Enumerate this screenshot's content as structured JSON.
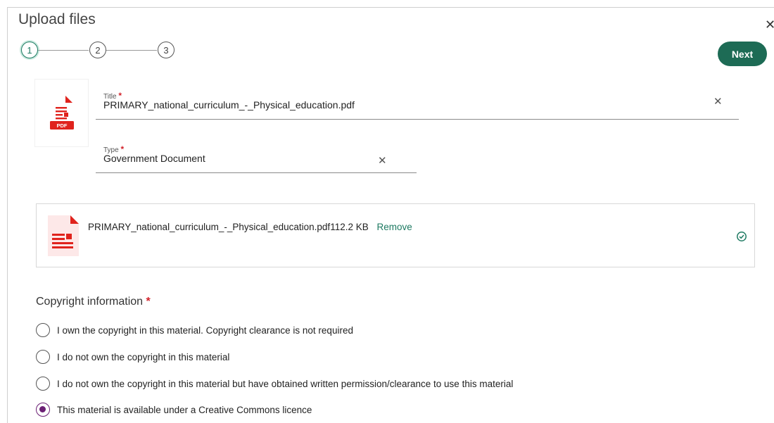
{
  "dialog": {
    "title": "Upload files",
    "close_icon": "close-icon"
  },
  "stepper": {
    "steps": [
      "1",
      "2",
      "3"
    ],
    "active_step": "1",
    "accent": "#1e7a62"
  },
  "actions": {
    "next_label": "Next",
    "next_color": "#1d6b55"
  },
  "form": {
    "title_label": "Title",
    "title_value": "PRIMARY_national_curriculum_-_Physical_education.pdf",
    "type_label": "Type",
    "type_value": "Government Document",
    "required_marker": "*"
  },
  "file": {
    "badge": "PDF",
    "name": "PRIMARY_national_curriculum_-_Physical_education.pdf",
    "size": "112.2 KB",
    "remove_label": "Remove",
    "status_icon": "check-circle-icon"
  },
  "copyright": {
    "heading": "Copyright information",
    "options": [
      "I own the copyright in this material. Copyright clearance is not required",
      "I do not own the copyright in this material",
      "I do not own the copyright in this material but have obtained written permission/clearance to use this material",
      "This material is available under a Creative Commons licence"
    ],
    "selected_index": 3,
    "radio_color": "#6b1f74"
  }
}
